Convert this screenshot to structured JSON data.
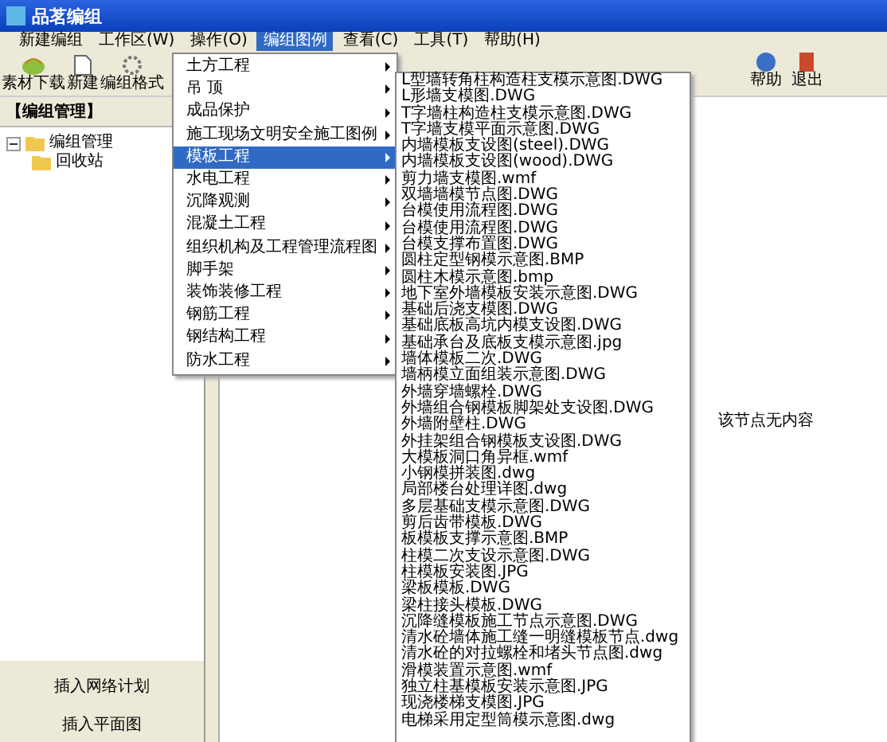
{
  "window": {
    "title": "品茗编组"
  },
  "menubar": [
    {
      "label": "新建编组",
      "selected": false
    },
    {
      "label": "工作区(W)",
      "selected": false
    },
    {
      "label": "操作(O)",
      "selected": false
    },
    {
      "label": "编组图例",
      "selected": true
    },
    {
      "label": "查看(C)",
      "selected": false
    },
    {
      "label": "工具(T)",
      "selected": false
    },
    {
      "label": "帮助(H)",
      "selected": false
    }
  ],
  "toolbar_left": [
    {
      "label": "素材下载",
      "kind": "download"
    },
    {
      "label": "新建",
      "kind": "new"
    },
    {
      "label": "编组格式",
      "kind": "format"
    }
  ],
  "toolbar_right": [
    {
      "label": "帮助",
      "kind": "help"
    },
    {
      "label": "退出",
      "kind": "exit"
    }
  ],
  "sidebar": {
    "title": "【编组管理】",
    "tree": [
      {
        "label": "编组管理",
        "expanded": true,
        "children": [
          {
            "label": "回收站"
          }
        ]
      }
    ],
    "buttons": [
      "插入网络计划",
      "插入平面图"
    ]
  },
  "dropdown": {
    "items": [
      {
        "label": "土方工程",
        "selected": false
      },
      {
        "label": "吊 顶",
        "selected": false
      },
      {
        "label": "成品保护",
        "selected": false
      },
      {
        "label": "施工现场文明安全施工图例",
        "selected": false
      },
      {
        "label": "模板工程",
        "selected": true
      },
      {
        "label": "水电工程",
        "selected": false
      },
      {
        "label": "沉降观测",
        "selected": false
      },
      {
        "label": "混凝土工程",
        "selected": false
      },
      {
        "label": "组织机构及工程管理流程图",
        "selected": false
      },
      {
        "label": "脚手架",
        "selected": false
      },
      {
        "label": "装饰装修工程",
        "selected": false
      },
      {
        "label": "钢筋工程",
        "selected": false
      },
      {
        "label": "钢结构工程",
        "selected": false
      },
      {
        "label": "防水工程",
        "selected": false
      }
    ]
  },
  "submenu": {
    "items": [
      "L型墙转角柱构造柱支模示意图.DWG",
      "L形墙支模图.DWG",
      "T字墙柱构造柱支模示意图.DWG",
      "T字墙支模平面示意图.DWG",
      "内墙模板支设图(steel).DWG",
      "内墙模板支设图(wood).DWG",
      "剪力墙支模图.wmf",
      "双墙墙模节点图.DWG",
      "台模使用流程图.DWG",
      "台模使用流程图.DWG",
      "台模支撑布置图.DWG",
      "圆柱定型钢模示意图.BMP",
      "圆柱木模示意图.bmp",
      "地下室外墙模板安装示意图.DWG",
      "基础后浇支模图.DWG",
      "基础底板高坑内模支设图.DWG",
      "基础承台及底板支模示意图.jpg",
      "墙体模板二次.DWG",
      "墙柄模立面组装示意图.DWG",
      "外墙穿墙螺栓.DWG",
      "外墙组合钢模板脚架处支设图.DWG",
      "外墙附壁柱.DWG",
      "外挂架组合钢模板支设图.DWG",
      "大模板洞口角异框.wmf",
      "小钢模拼装图.dwg",
      "局部楼台处理详图.dwg",
      "多层基础支模示意图.DWG",
      "剪后齿带模板.DWG",
      "板模板支撑示意图.BMP",
      "柱模二次支设示意图.DWG",
      "柱模板安装图.JPG",
      "梁板模板.DWG",
      "梁柱接头模板.DWG",
      "沉降缝模板施工节点示意图.DWG",
      "清水砼墙体施工缝一明缝模板节点.dwg",
      "清水砼的对拉螺栓和堵头节点图.dwg",
      "滑模装置示意图.wmf",
      "独立柱基模板安装示意图.JPG",
      "现浇楼梯支模图.JPG",
      "电梯采用定型筒模示意图.dwg"
    ]
  },
  "content": {
    "message": "该节点无内容"
  }
}
